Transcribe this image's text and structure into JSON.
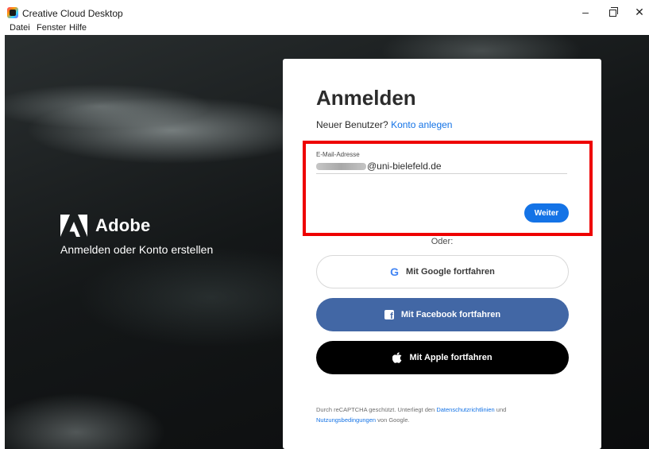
{
  "window": {
    "title": "Creative Cloud Desktop",
    "minimize_glyph": "–",
    "close_glyph": "✕"
  },
  "menu": {
    "items": [
      "Datei",
      "Fenster",
      "Hilfe"
    ]
  },
  "brand": {
    "name": "Adobe",
    "tagline": "Anmelden oder Konto erstellen"
  },
  "signin": {
    "title": "Anmelden",
    "new_user_prefix": "Neuer Benutzer?",
    "create_account_link": "Konto anlegen",
    "email_label": "E-Mail-Adresse",
    "email_value_visible": "@uni-bielefeld.de",
    "continue_button": "Weiter",
    "or_divider": "Oder:",
    "google_button": "Mit Google fortfahren",
    "google_glyph": "G",
    "facebook_button": "Mit Facebook fortfahren",
    "apple_button": "Mit Apple fortfahren",
    "legal": {
      "prefix": "Durch reCAPTCHA geschützt. Unterliegt den",
      "privacy_link": "Datenschutzrichtlinien",
      "and": "und",
      "terms_link": "Nutzungsbedingungen",
      "suffix": "von Google."
    }
  },
  "colors": {
    "accent_blue": "#1473e6",
    "facebook_blue": "#4267a5",
    "highlight_red": "#ee0000",
    "background_dark": "#141718"
  },
  "icons": {
    "app": "creative-cloud-icon",
    "brand": "adobe-logo-icon",
    "google": "google-icon",
    "facebook": "facebook-icon",
    "apple": "apple-icon"
  }
}
